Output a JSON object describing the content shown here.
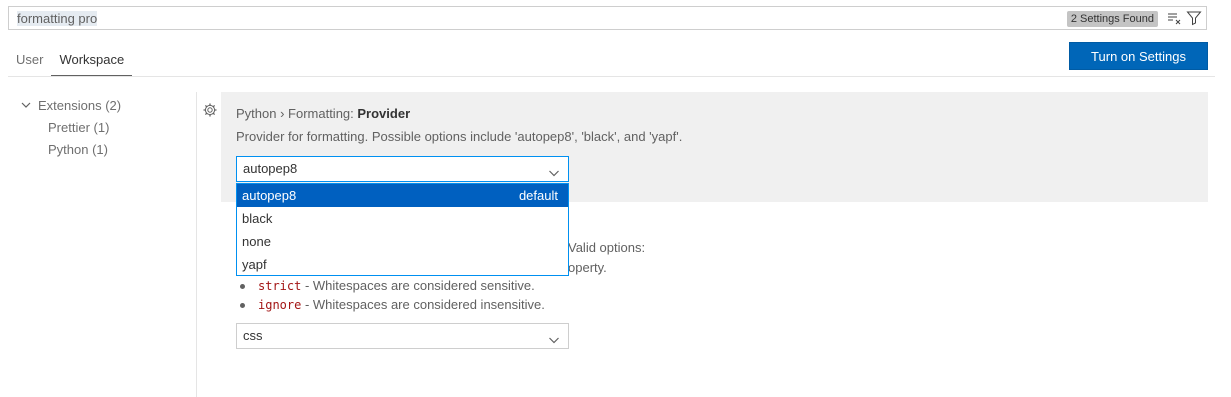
{
  "search": {
    "value": "formatting pro",
    "found_badge": "2 Settings Found",
    "clear_icon": "clear-filter-icon",
    "filter_icon": "filter-icon"
  },
  "tabs": [
    {
      "label": "User",
      "active": false
    },
    {
      "label": "Workspace",
      "active": true
    }
  ],
  "sync_button": "Turn on Settings Sync",
  "toc": {
    "group": "Extensions (2)",
    "items": [
      {
        "label": "Prettier (1)"
      },
      {
        "label": "Python (1)"
      }
    ]
  },
  "setting": {
    "category": "Python › Formatting: ",
    "name": "Provider",
    "description": "Provider for formatting. Possible options include 'autopep8', 'black', and 'yapf'.",
    "value": "autopep8",
    "options": [
      {
        "label": "autopep8",
        "note": "default"
      },
      {
        "label": "black",
        "note": ""
      },
      {
        "label": "none",
        "note": ""
      },
      {
        "label": "yapf",
        "note": ""
      }
    ]
  },
  "background_setting": {
    "desc_fragment_1": "Valid options:",
    "desc_fragment_2": "operty.",
    "bullets": [
      {
        "code": "strict",
        "text": " - Whitespaces are considered sensitive."
      },
      {
        "code": "ignore",
        "text": " - Whitespaces are considered insensitive."
      }
    ],
    "value": "css"
  },
  "colors": {
    "accent": "#0066b8",
    "selection": "#0060c0",
    "focus_border": "#0090f1",
    "code": "#a31515"
  }
}
